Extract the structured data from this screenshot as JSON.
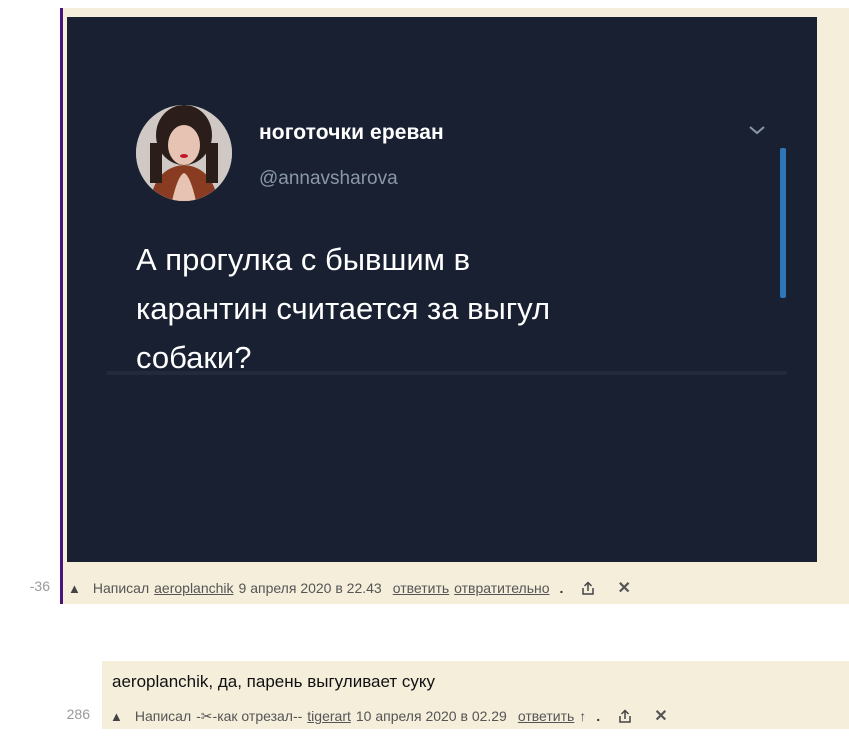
{
  "comment1": {
    "score": "-36",
    "image": {
      "tweet_name": "ноготочки ереван",
      "tweet_handle": "@annavsharova",
      "tweet_text_line1": "А прогулка с бывшим в",
      "tweet_text_line2": "карантин считается за выгул",
      "tweet_text_line3": "собаки?"
    },
    "meta": {
      "wrote_label": "Написал",
      "author": "aeroplanchik",
      "date": "9 апреля 2020 в 22.43",
      "reply_label": "ответить",
      "vote_label": "отвратительно",
      "dot": "."
    }
  },
  "comment2": {
    "score": "286",
    "text": "aeroplanchik, да, парень выгуливает суку",
    "meta": {
      "wrote_label": "Написал",
      "prefix": "-✂-как отрезал--",
      "author": "tigerart",
      "date": "10 апреля 2020 в 02.29",
      "reply_label": "ответить",
      "arrow": "↑",
      "dot": "."
    }
  },
  "icons": {
    "upvote": "▲",
    "close": "✕"
  },
  "colors": {
    "comment_bg": "#f4eedb",
    "thread_bar": "#4b1478",
    "tweet_bg": "#182032"
  }
}
